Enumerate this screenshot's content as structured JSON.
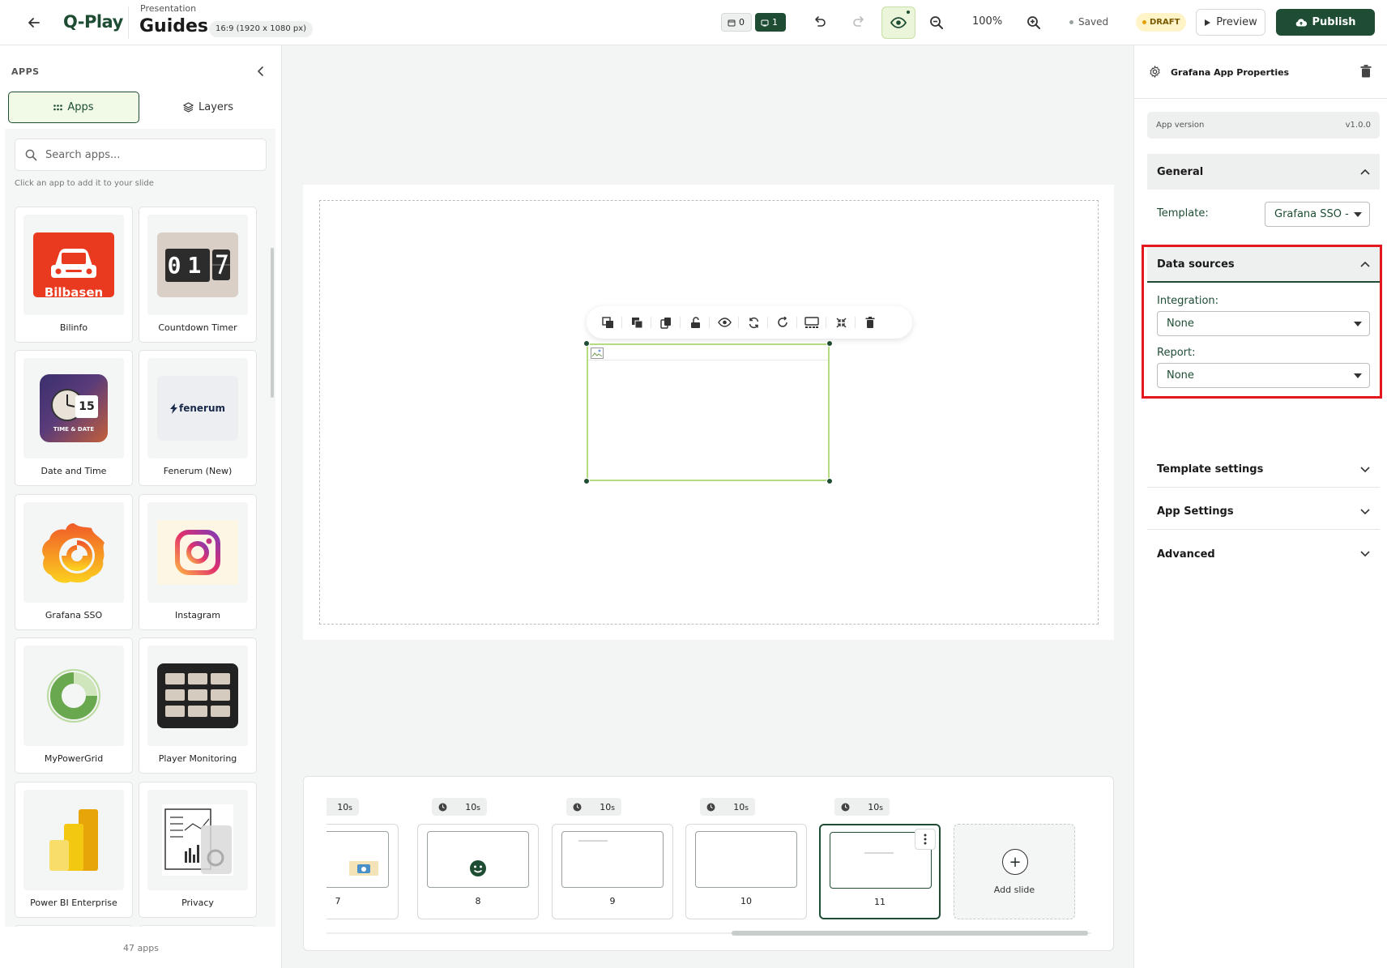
{
  "header": {
    "logo": "Q-Play",
    "presentation_kind": "Presentation",
    "title": "Guides",
    "resolution": "16:9 (1920 x 1080 px)",
    "chip_a_count": "0",
    "chip_b_count": "1",
    "zoom": "100%",
    "saved": "Saved",
    "draft": "DRAFT",
    "preview": "Preview",
    "publish": "Publish"
  },
  "sidebar": {
    "section_title": "APPS",
    "tabs": [
      {
        "label": "Apps"
      },
      {
        "label": "Layers"
      }
    ],
    "search_placeholder": "Search apps...",
    "hint": "Click an app to add it to your slide",
    "apps": [
      {
        "name": "Bilinfo",
        "badge": "Bilbasen"
      },
      {
        "name": "Countdown Timer",
        "digits": "01"
      },
      {
        "name": "Date and Time",
        "day": "15",
        "caption": "TIME & DATE"
      },
      {
        "name": "Fenerum (New)",
        "wordmark": "fenerum"
      },
      {
        "name": "Grafana SSO"
      },
      {
        "name": "Instagram"
      },
      {
        "name": "MyPowerGrid"
      },
      {
        "name": "Player Monitoring"
      },
      {
        "name": "Power BI Enterprise"
      },
      {
        "name": "Privacy"
      }
    ],
    "count": "47 apps"
  },
  "filmstrip": {
    "slides": [
      {
        "number": "7",
        "duration": "10",
        "unit": "s"
      },
      {
        "number": "8",
        "duration": "10",
        "unit": "s"
      },
      {
        "number": "9",
        "duration": "10",
        "unit": "s"
      },
      {
        "number": "10",
        "duration": "10",
        "unit": "s"
      },
      {
        "number": "11",
        "duration": "10",
        "unit": "s"
      }
    ],
    "add_slide": "Add slide"
  },
  "properties": {
    "title": "Grafana App Properties",
    "app_version_label": "App version",
    "app_version": "v1.0.0",
    "general": "General",
    "template_label": "Template:",
    "template_value": "Grafana SSO -",
    "data_sources": "Data sources",
    "integration_label": "Integration:",
    "integration_value": "None",
    "report_label": "Report:",
    "report_value": "None",
    "template_settings": "Template settings",
    "app_settings": "App Settings",
    "advanced": "Advanced"
  },
  "colors": {
    "brand": "#1e4d34",
    "highlight": "#e3181f",
    "selection": "#b6dc82"
  }
}
